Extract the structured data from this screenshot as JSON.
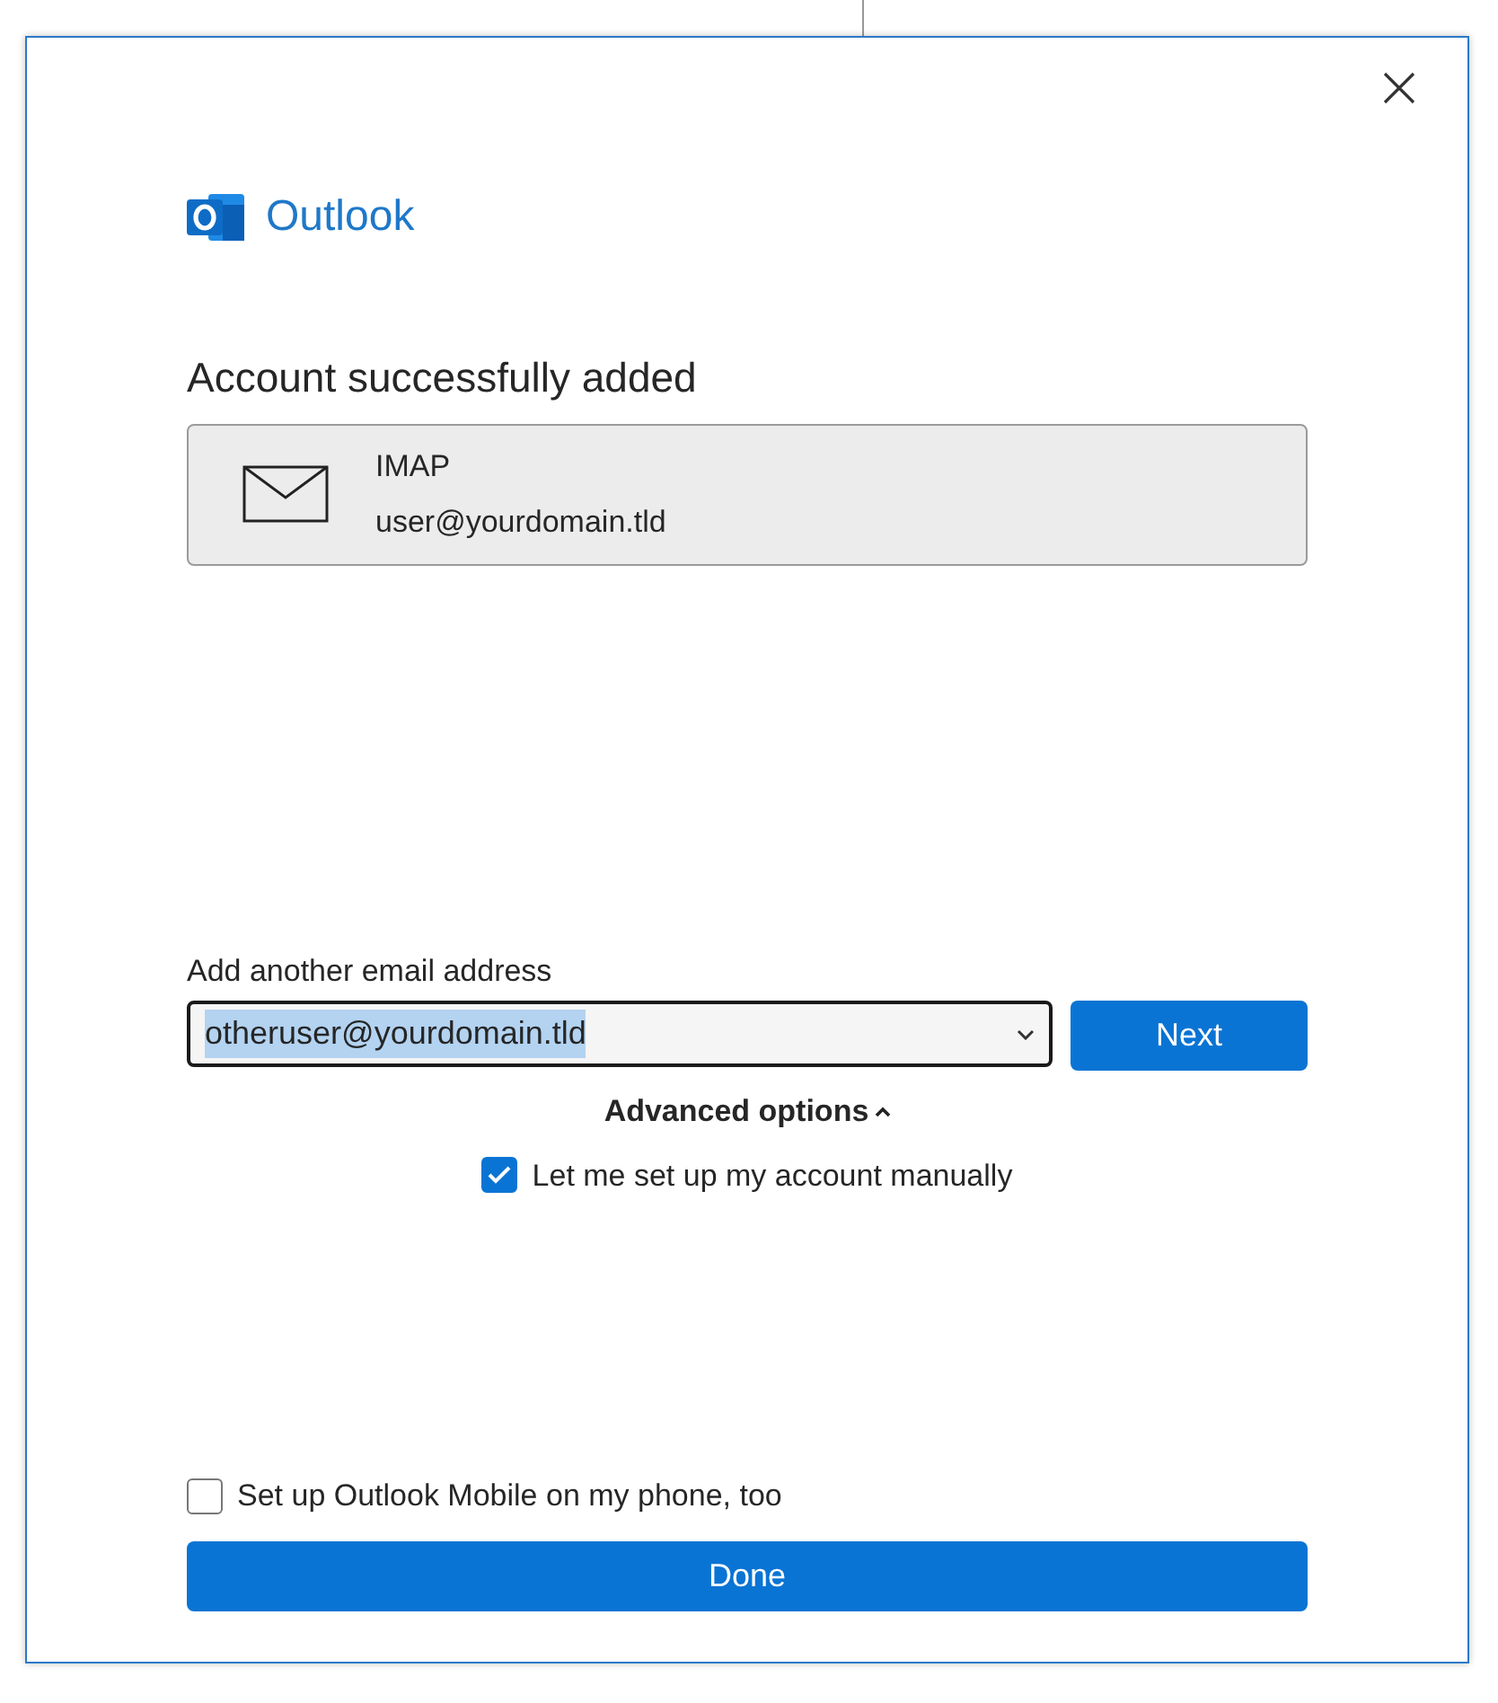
{
  "app": {
    "name": "Outlook"
  },
  "heading": "Account successfully added",
  "account": {
    "type": "IMAP",
    "email": "user@yourdomain.tld"
  },
  "add_email": {
    "label": "Add another email address",
    "value": "otheruser@yourdomain.tld",
    "value_highlighted": true,
    "focused": true
  },
  "next_button": "Next",
  "advanced_options": {
    "label": "Advanced options",
    "expanded": true
  },
  "checkboxes": [
    {
      "label": "Let me set up my account manually",
      "checked": true
    },
    {
      "label": "Set up Outlook Mobile on my phone, too",
      "checked": false
    }
  ],
  "done_button": "Done"
}
